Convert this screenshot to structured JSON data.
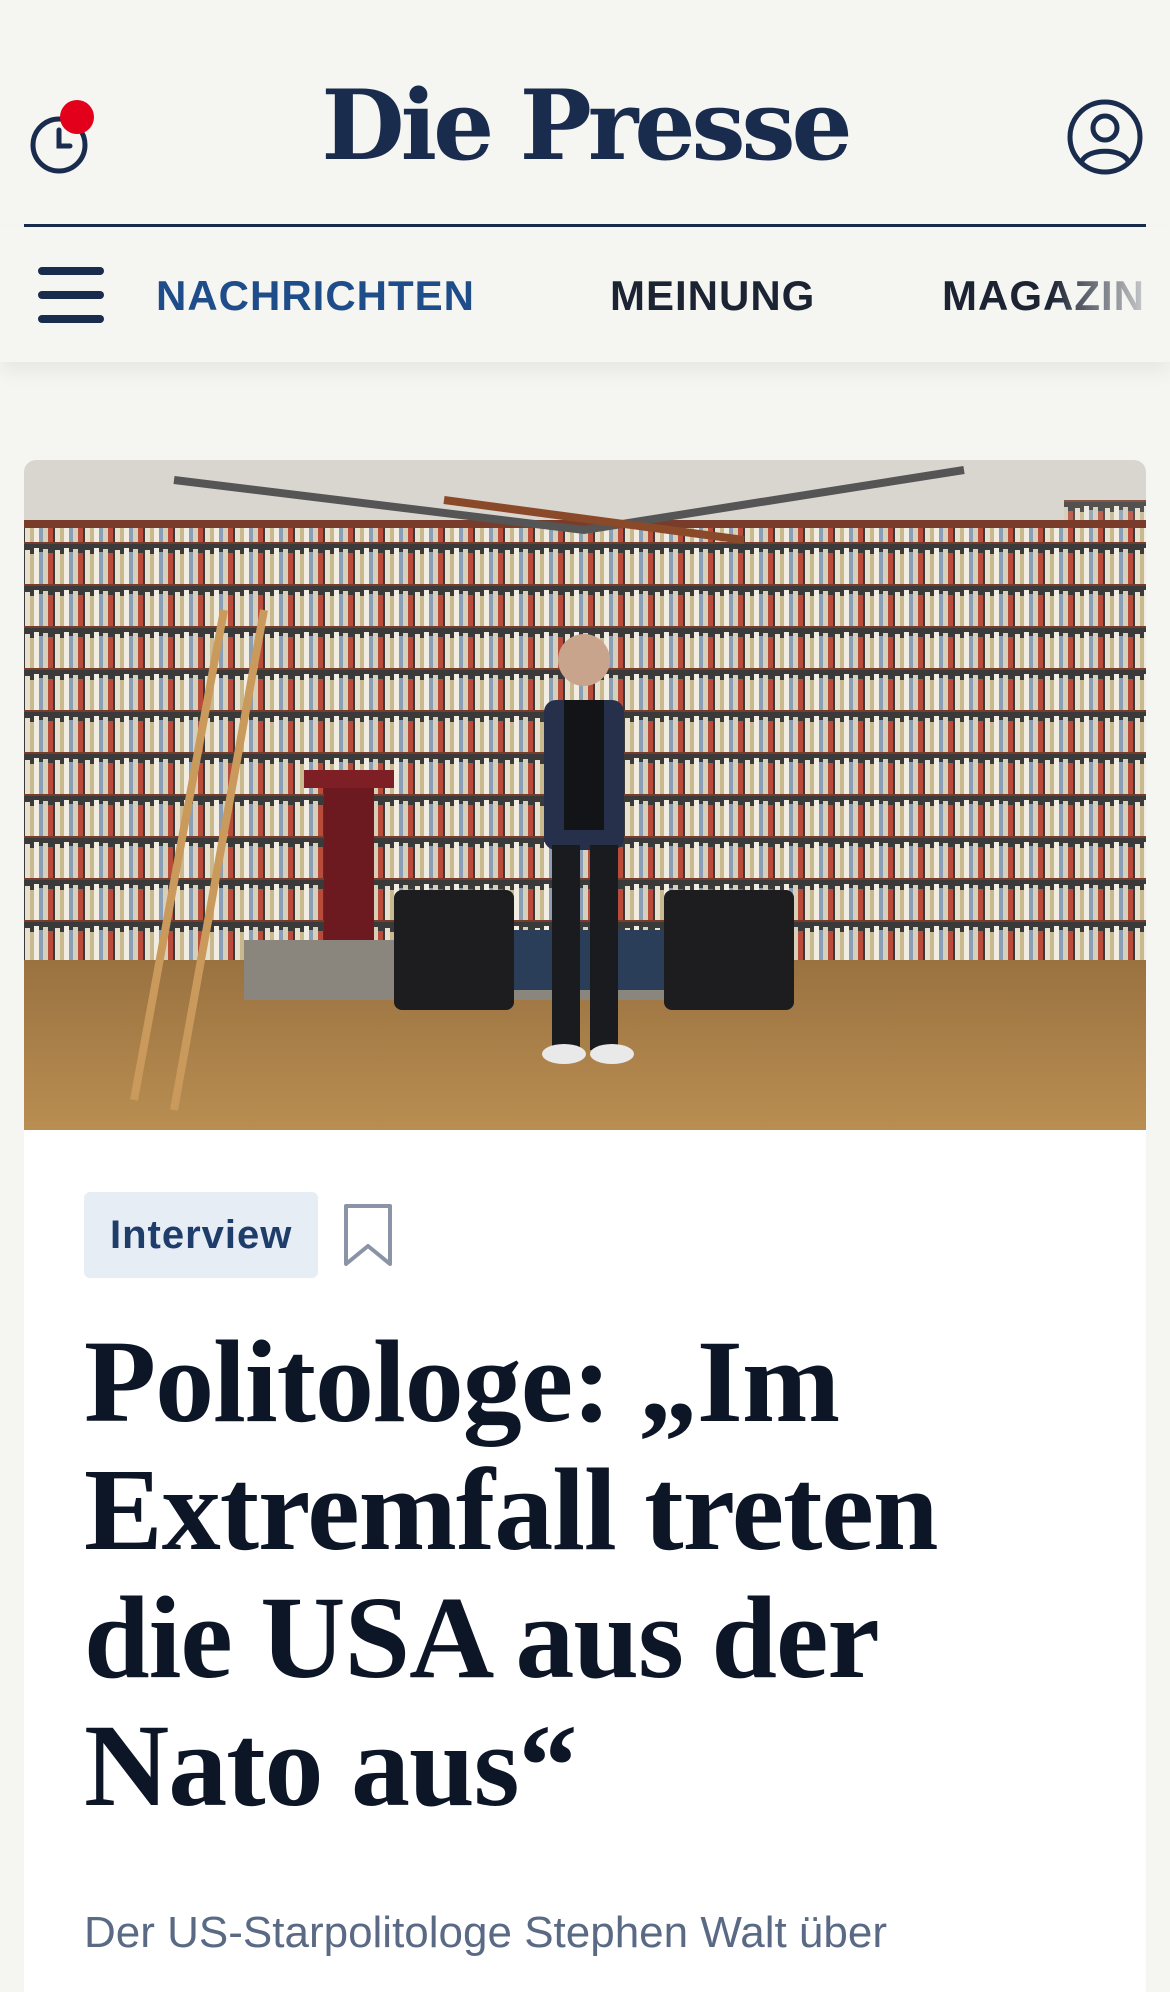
{
  "header": {
    "logo": "Die Presse",
    "history_icon": "clock-icon",
    "account_icon": "user-circle-icon",
    "notification_color": "#e3001b"
  },
  "nav": {
    "menu_icon": "hamburger-menu-icon",
    "items": [
      {
        "label": "NACHRICHTEN",
        "active": true
      },
      {
        "label": "MEINUNG",
        "active": false
      },
      {
        "label": "MAGAZIN",
        "active": false
      }
    ]
  },
  "article": {
    "image_icon": "hero-photo",
    "tag": "Interview",
    "bookmark_icon": "bookmark-icon",
    "headline": "Politologe: „Im Extremfall treten die USA aus der Nato aus“",
    "lead": "Der US-Starpolitologe Stephen Walt über"
  },
  "colors": {
    "brand": "#1a2c4e",
    "nav_active": "#1f4d8a",
    "tag_bg": "#e7edf4",
    "lead_text": "#5a6a85"
  }
}
